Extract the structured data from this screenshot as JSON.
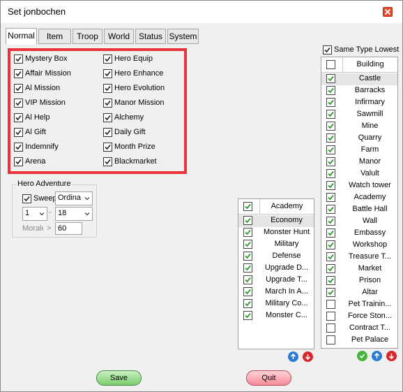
{
  "window": {
    "title": "Set jonbochen"
  },
  "tabs": [
    "Normal",
    "Item",
    "Troop",
    "World",
    "Status",
    "System"
  ],
  "normal_options": {
    "left": [
      "Mystery Box",
      "Affair Mission",
      "Al Mission",
      "VIP Mission",
      "Al Help",
      "Al Gift",
      "Indemnify",
      "Arena"
    ],
    "right": [
      "Hero Equip",
      "Hero Enhance",
      "Hero Evolution",
      "Manor Mission",
      "Alchemy",
      "Daily Gift",
      "Month Prize",
      "Blackmarket"
    ]
  },
  "hero_adventure": {
    "legend": "Hero Adventure",
    "sweep_label": "Sweep",
    "mode_value": "Ordina",
    "from_value": "1",
    "dash": "-",
    "to_value": "18",
    "morale_label": "Morale",
    "morale_op": ">",
    "morale_value": "60"
  },
  "same_type_lowest": "Same Type Lowest",
  "academy_list": {
    "header": "Academy",
    "items": [
      "Economy",
      "Monster Hunt",
      "Military",
      "Defense",
      "Upgrade D...",
      "Upgrade T...",
      "March In A...",
      "Military Co...",
      "Monster C..."
    ]
  },
  "building_list": {
    "header": "Building",
    "items": [
      {
        "label": "Castle",
        "checked": true
      },
      {
        "label": "Barracks",
        "checked": true
      },
      {
        "label": "Infirmary",
        "checked": true
      },
      {
        "label": "Sawmill",
        "checked": true
      },
      {
        "label": "Mine",
        "checked": true
      },
      {
        "label": "Quarry",
        "checked": true
      },
      {
        "label": "Farm",
        "checked": true
      },
      {
        "label": "Manor",
        "checked": true
      },
      {
        "label": "Valult",
        "checked": true
      },
      {
        "label": "Watch tower",
        "checked": true
      },
      {
        "label": "Academy",
        "checked": true
      },
      {
        "label": "Battle Hall",
        "checked": true
      },
      {
        "label": "Wall",
        "checked": true
      },
      {
        "label": "Embassy",
        "checked": true
      },
      {
        "label": "Workshop",
        "checked": true
      },
      {
        "label": "Treasure T...",
        "checked": true
      },
      {
        "label": "Market",
        "checked": true
      },
      {
        "label": "Prison",
        "checked": true
      },
      {
        "label": "Altar",
        "checked": true
      },
      {
        "label": "Pet Trainin...",
        "checked": false
      },
      {
        "label": "Force Ston...",
        "checked": false
      },
      {
        "label": "Contract T...",
        "checked": false
      },
      {
        "label": "Pet Palace",
        "checked": false
      }
    ]
  },
  "buttons": {
    "save": "Save",
    "quit": "Quit"
  },
  "colors": {
    "highlight_box": "#e8333a",
    "check_green": "#2e9a2e",
    "up_blue": "#2a7ad8",
    "down_red": "#d8262a"
  }
}
